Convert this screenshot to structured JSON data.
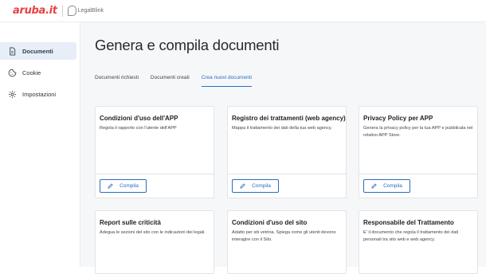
{
  "brand": {
    "name": "aruba.it",
    "partner": "LegalBlink"
  },
  "sidebar": {
    "items": [
      {
        "label": "Documenti",
        "icon": "document-icon",
        "active": true
      },
      {
        "label": "Cookie",
        "icon": "cookie-icon",
        "active": false
      },
      {
        "label": "Impostazioni",
        "icon": "gear-icon",
        "active": false
      }
    ]
  },
  "main": {
    "title": "Genera e compila documenti",
    "tabs": [
      {
        "label": "Documenti richiesti",
        "active": false
      },
      {
        "label": "Documenti creati",
        "active": false
      },
      {
        "label": "Crea nuovi documenti",
        "active": true
      }
    ],
    "cards": [
      {
        "title": "Condizioni d'uso dell'APP",
        "description": "Regola il rapporto con l'utente dell'APP",
        "button": "Compila"
      },
      {
        "title": "Registro dei trattamenti (web agency)",
        "description": "Mappa il trattamento dei dati della tua web agency.",
        "button": "Compila"
      },
      {
        "title": "Privacy Policy per APP",
        "description": "Genera la privacy policy per la tua APP e pubblicala nel relativo APP Store.",
        "button": "Compila"
      },
      {
        "title": "Report sulle criticità",
        "description": "Adegua le sezioni del sito con le indicazioni dei legali.",
        "button": ""
      },
      {
        "title": "Condizioni d'uso del sito",
        "description": "Adatto per siti vetrina. Spiega come gli utenti devono interagire con il Sito.",
        "button": ""
      },
      {
        "title": "Responsabile del Trattamento",
        "description": "E' il documento che regola il trattamento dei dati personali tra sito web e web agency.",
        "button": ""
      }
    ]
  },
  "colors": {
    "accent": "#2a6cc5",
    "brand_red": "#e8423f",
    "active_bg": "#e7eef8"
  }
}
